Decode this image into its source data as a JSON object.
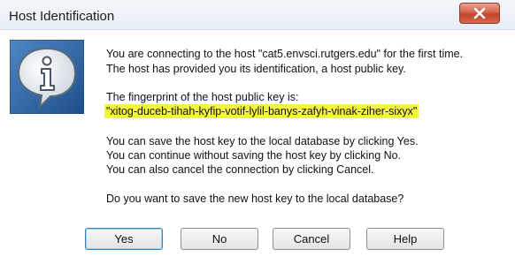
{
  "window": {
    "title": "Host Identification"
  },
  "message": {
    "line1": "You are connecting to the host \"cat5.envsci.rutgers.edu\" for the first time.",
    "line2": "The host has provided you its identification, a host public key.",
    "fingerprint_label": "The fingerprint of the host public key is:",
    "fingerprint": "\"xitog-duceb-tihah-kyfip-votif-lylil-banys-zafyh-vinak-ziher-sixyx\"",
    "option1": "You can save the host key to the local database by clicking Yes.",
    "option2": "You can continue without saving the host key by clicking No.",
    "option3": "You can also cancel the connection by clicking Cancel.",
    "question": "Do you want to save the new host key to the local database?"
  },
  "buttons": {
    "yes": "Yes",
    "no": "No",
    "cancel": "Cancel",
    "help": "Help"
  },
  "icons": {
    "dialog_icon": "info-speech-bubble-icon",
    "close": "close-icon"
  },
  "colors": {
    "highlight": "#f4f442",
    "close_button": "#c1442a",
    "icon_blue": "#2f6fae"
  }
}
